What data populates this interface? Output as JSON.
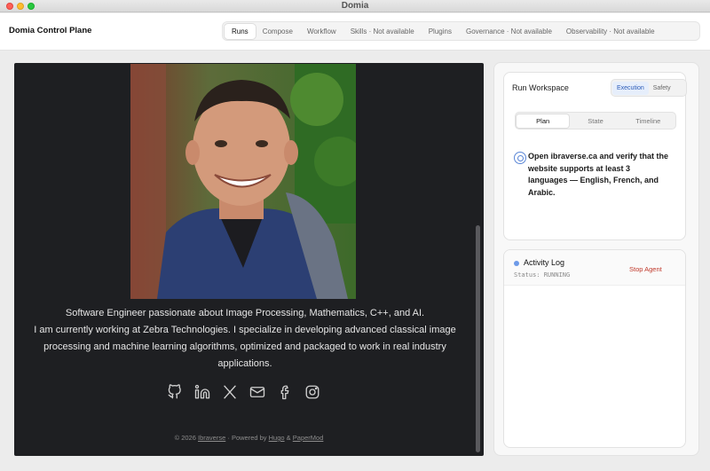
{
  "window": {
    "title": "Domia"
  },
  "app": {
    "brand": "Domia Control Plane"
  },
  "nav": {
    "tabs": [
      {
        "label": "Runs",
        "active": true
      },
      {
        "label": "Compose"
      },
      {
        "label": "Workflow"
      },
      {
        "label": "Skills · Not available"
      },
      {
        "label": "Plugins"
      },
      {
        "label": "Governance · Not available"
      },
      {
        "label": "Observability · Not available"
      }
    ]
  },
  "browser": {
    "bio": {
      "line1": "Software Engineer passionate about Image Processing, Mathematics, C++, and AI.",
      "line2": "I am currently working at Zebra Technologies. I specialize in developing advanced classical image processing and machine learning algorithms, optimized and packaged to work in real industry applications."
    },
    "socials": [
      "github-icon",
      "linkedin-icon",
      "x-icon",
      "mail-icon",
      "facebook-icon",
      "instagram-icon"
    ],
    "footer": {
      "prefix": "© 2026",
      "site": "Ibraverse",
      "powered": "· Powered by",
      "hugo": "Hugo",
      "amp": "&",
      "theme": "PaperMod"
    }
  },
  "workspace": {
    "title": "Run Workspace",
    "toggle": {
      "execution": "Execution",
      "safety": "Safety"
    },
    "tabs": {
      "plan": "Plan",
      "state": "State",
      "timeline": "Timeline"
    },
    "task": "Open ibraverse.ca and verify that the website supports at least 3 languages — English, French, and Arabic."
  },
  "activity": {
    "title": "Activity Log",
    "status": "Status: RUNNING",
    "stop": "Stop Agent"
  },
  "colors": {
    "accent": "#2a5bb8",
    "danger": "#c0392b",
    "page_bg": "#1e1f22"
  }
}
